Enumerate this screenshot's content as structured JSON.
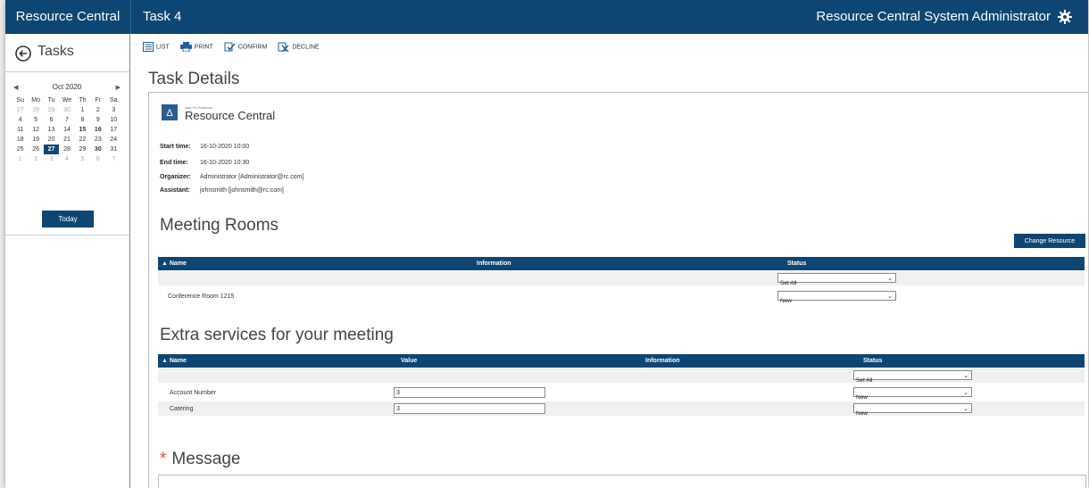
{
  "app": {
    "brand": "Resource Central",
    "task_title": "Task 4",
    "user": "Resource Central System Administrator"
  },
  "sidebar": {
    "title": "Tasks",
    "calendar": {
      "month": "Oct 2020",
      "weekdays": [
        "Su",
        "Mo",
        "Tu",
        "We",
        "Th",
        "Fr",
        "Sa"
      ],
      "weeks": [
        [
          "27",
          "28",
          "29",
          "30",
          "1",
          "2",
          "3"
        ],
        [
          "4",
          "5",
          "6",
          "7",
          "8",
          "9",
          "10"
        ],
        [
          "11",
          "12",
          "13",
          "14",
          "15",
          "16",
          "17"
        ],
        [
          "18",
          "19",
          "20",
          "21",
          "22",
          "23",
          "24"
        ],
        [
          "25",
          "26",
          "27",
          "28",
          "29",
          "30",
          "31"
        ],
        [
          "1",
          "2",
          "3",
          "4",
          "5",
          "6",
          "7"
        ]
      ],
      "selected": "27"
    },
    "today_label": "Today"
  },
  "toolbar": {
    "list": "LIST",
    "print": "PRINT",
    "confirm": "CONFIRM",
    "decline": "DECLINE"
  },
  "page": {
    "title": "Task Details",
    "logo_small": "Add-On Products",
    "logo_name": "Resource Central",
    "details": [
      {
        "label": "Start time:",
        "value": "16-10-2020 10:00"
      },
      {
        "label": "End time:",
        "value": "16-10-2020 10:30"
      },
      {
        "label": "Organizer:",
        "value": "Administrator [Administrator@rc.com]"
      },
      {
        "label": "Assistant:",
        "value": "johnsmith [johnsmith@rc.com]"
      }
    ]
  },
  "rooms": {
    "title": "Meeting Rooms",
    "change_btn": "Change Resource",
    "cols": {
      "name": "Name",
      "info": "Information",
      "status": "Status"
    },
    "set_all": "Set All",
    "rows": [
      {
        "name": "Conference Room 1215",
        "status": "New"
      }
    ]
  },
  "services": {
    "title": "Extra services for your meeting",
    "cols": {
      "name": "Name",
      "value": "Value",
      "info": "Information",
      "status": "Status"
    },
    "set_all": "Set All",
    "rows": [
      {
        "name": "Account Number",
        "value": "3",
        "status": "New"
      },
      {
        "name": "Catering",
        "value": "3",
        "status": "New"
      }
    ]
  },
  "message": {
    "required_mark": "*",
    "title": "Message"
  }
}
